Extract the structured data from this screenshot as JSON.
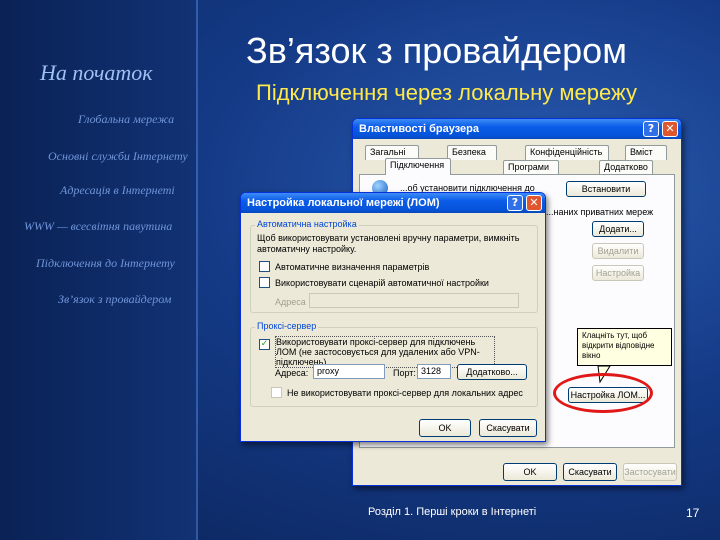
{
  "nav": {
    "home": "На початок",
    "items": [
      "Глобальна мережа",
      "Основні служби Інтернету",
      "Адресація в Інтернеті",
      "WWW — всесвітня павутина",
      "Підключення до Інтернету",
      "Зв’язок з провайдером"
    ]
  },
  "slide": {
    "title": "Зв’язок з провайдером",
    "subtitle": "Підключення через локальну мережу",
    "footer": "Розділ 1. Перші кроки в Інтернеті",
    "page": "17"
  },
  "browser_dialog": {
    "title": "Властивості браузера",
    "help": "?",
    "close": "✕",
    "tabs_row1": [
      "Загальні",
      "Безпека",
      "Конфіденційність",
      "Вміст"
    ],
    "tabs_row2": [
      "Підключення",
      "Програми",
      "Додатково"
    ],
    "setup_text": "...об установити підключення до",
    "setup_button": "Встановити",
    "vpn_text": "...наних приватних мереж",
    "add_button": "Додати...",
    "delete_button": "Видалити",
    "settings_button": "Настройка",
    "lan_button": "Настройка ЛОМ...",
    "ok": "OK",
    "cancel": "Скасувати",
    "apply": "Застосувати"
  },
  "lan_dialog": {
    "title": "Настройка локальної мережі (ЛОМ)",
    "help": "?",
    "close": "✕",
    "auto_group": "Автоматична настройка",
    "auto_desc": "Щоб використовувати установлені вручну параметри, вимкніть автоматичну настройку.",
    "auto_detect": "Автоматичне визначення параметрів",
    "use_script": "Використовувати сценарій автоматичної настройки",
    "address_label": "Адреса",
    "proxy_group": "Проксі-сервер",
    "proxy_desc": "Використовувати проксі-сервер для підключень ЛОМ (не застосовується для удалених або VPN-підключень)",
    "proxy_checked": "✓",
    "proxy_address_label": "Адреса:",
    "proxy_address_value": "proxy",
    "port_label": "Порт:",
    "port_value": "3128",
    "advanced_button": "Додатково...",
    "bypass": "Не використовувати проксі-сервер для локальних адрес",
    "ok": "OK",
    "cancel": "Скасувати"
  },
  "callout": "Клацніть тут, щоб відкрити відповідне вікно",
  "colors": {
    "accent": "#ffe94a",
    "highlight": "#e01818"
  }
}
